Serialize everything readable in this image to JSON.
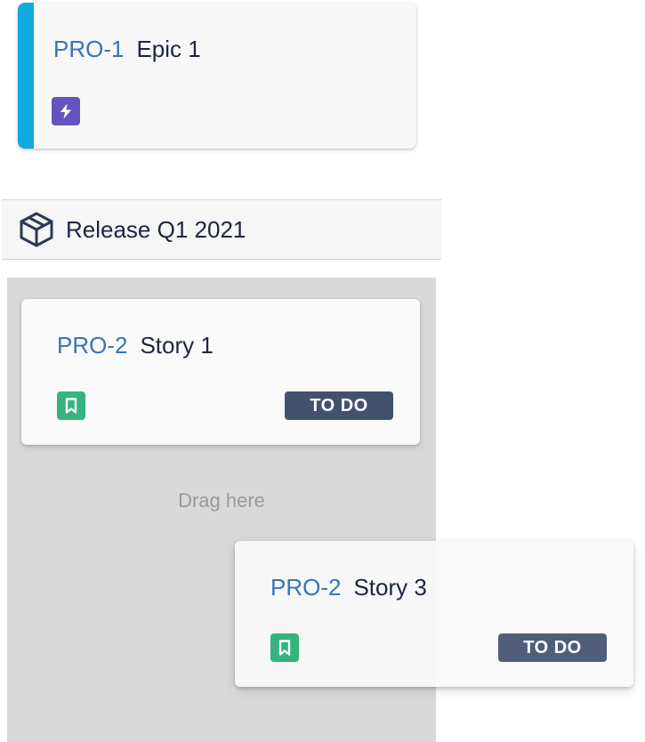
{
  "epic": {
    "key": "PRO-1",
    "summary": "Epic 1",
    "type_icon": "lightning-bolt-icon",
    "accent_color": "#14a9de",
    "icon_color": "#6554c0"
  },
  "release": {
    "icon": "box-package-icon",
    "title": "Release Q1 2021"
  },
  "drop_zone": {
    "hint": "Drag here"
  },
  "stories": [
    {
      "key": "PRO-2",
      "summary": "Story 1",
      "type_icon": "bookmark-icon",
      "icon_color": "#36b37e",
      "status": "TO DO"
    },
    {
      "key": "PRO-2",
      "summary": "Story 3",
      "type_icon": "bookmark-icon",
      "icon_color": "#36b37e",
      "status": "TO DO"
    }
  ]
}
